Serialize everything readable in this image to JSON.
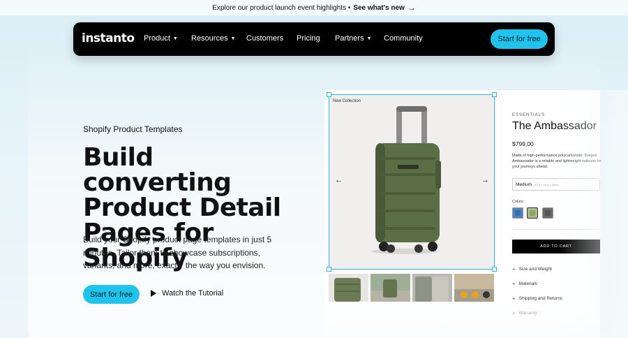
{
  "announcement": {
    "text": "Explore our product launch event highlights •",
    "link": "See what's new",
    "arrow": "→"
  },
  "nav": {
    "logo": "instanto",
    "items": [
      {
        "label": "Product",
        "caret": "▼"
      },
      {
        "label": "Resources",
        "caret": "▼"
      },
      {
        "label": "Customers"
      },
      {
        "label": "Pricing"
      },
      {
        "label": "Partners",
        "caret": "▼"
      },
      {
        "label": "Community"
      }
    ],
    "cta": "Start for free"
  },
  "hero": {
    "eyebrow": "Shopify Product Templates",
    "headline_lines": [
      "Build converting",
      "Product Detail",
      "Pages for Shopify"
    ],
    "body": "Build your Shopify product page templates in just 5 minutes. Tailor them to showcase subscriptions, variants, and more, exactly the way you envision.",
    "cta": "Start for free",
    "watch": "Watch the Tutorial"
  },
  "product": {
    "badge": "New Collection",
    "prev_arrow": "←",
    "next_arrow": "→",
    "eyebrow": "ESSENTIALS",
    "title": "The Ambassador",
    "price": "$799,00",
    "description": "Made of high-performance polycarbonate, Dregon Ambassador is a reliable and lightweight suitcase for your journeys ahead.",
    "size_value": "Medium",
    "size_dims": "67.5 × 44.5 × 28cm",
    "colors_label": "Colors",
    "swatches": [
      {
        "name": "blue",
        "color": "#4d86c7"
      },
      {
        "name": "green",
        "color": "#a9bd86"
      },
      {
        "name": "gray",
        "color": "#6b6b6b"
      }
    ],
    "cart": "ADD TO CART",
    "accordion": [
      "Size and Weight",
      "Materials",
      "Shipping and Returns",
      "Warranty"
    ]
  },
  "colors": {
    "accent": "#1fc3ec",
    "selection": "#29b7de",
    "suitcase": "#5c6e46"
  }
}
